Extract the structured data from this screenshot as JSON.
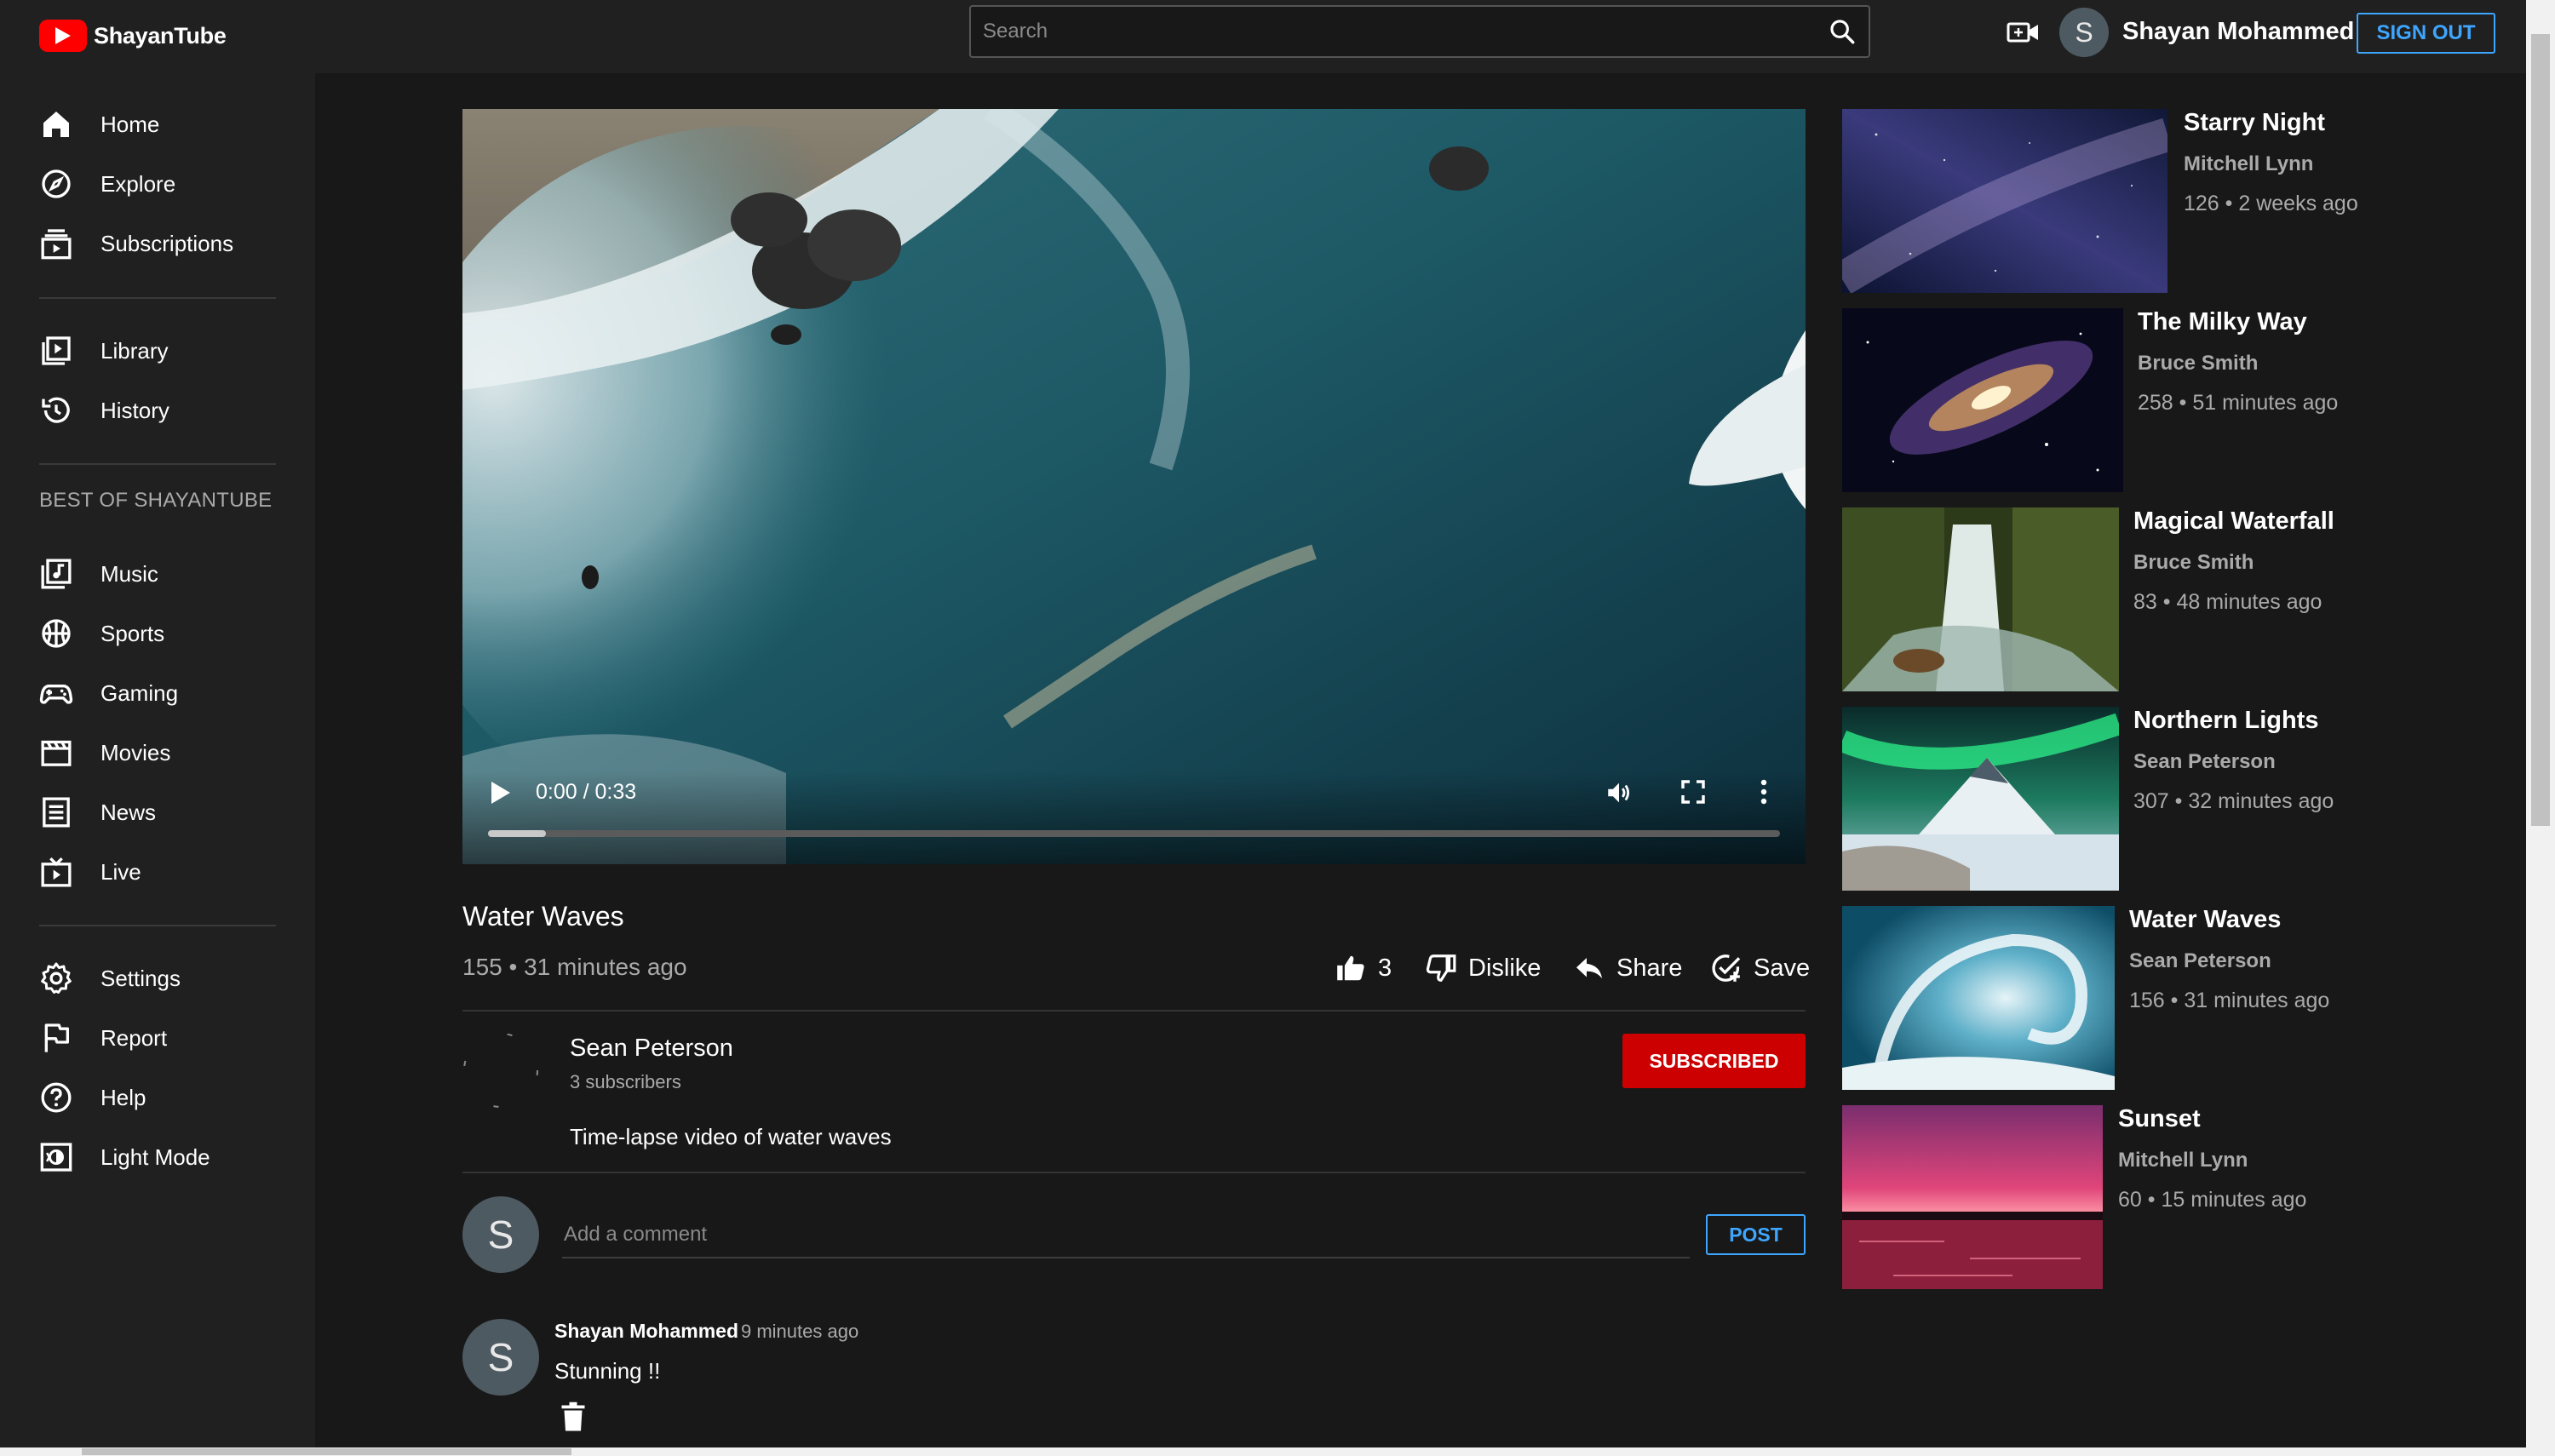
{
  "app": {
    "name": "ShayanTube"
  },
  "search": {
    "placeholder": "Search"
  },
  "user": {
    "initial": "S",
    "name": "Shayan Mohammed",
    "signout_label": "SIGN OUT"
  },
  "sidebar": {
    "items": [
      {
        "label": "Home",
        "icon": "home-icon"
      },
      {
        "label": "Explore",
        "icon": "compass-icon"
      },
      {
        "label": "Subscriptions",
        "icon": "subscriptions-icon"
      },
      {
        "label": "Library",
        "icon": "library-icon"
      },
      {
        "label": "History",
        "icon": "history-icon"
      }
    ],
    "section_title": "BEST OF SHAYANTUBE",
    "best_of": [
      {
        "label": "Music",
        "icon": "music-icon"
      },
      {
        "label": "Sports",
        "icon": "sports-icon"
      },
      {
        "label": "Gaming",
        "icon": "gaming-icon"
      },
      {
        "label": "Movies",
        "icon": "movies-icon"
      },
      {
        "label": "News",
        "icon": "news-icon"
      },
      {
        "label": "Live",
        "icon": "live-icon"
      }
    ],
    "bottom": [
      {
        "label": "Settings",
        "icon": "gear-icon"
      },
      {
        "label": "Report",
        "icon": "flag-icon"
      },
      {
        "label": "Help",
        "icon": "help-icon"
      },
      {
        "label": "Light Mode",
        "icon": "light-mode-icon"
      }
    ]
  },
  "player": {
    "time": "0:00 / 0:33",
    "progress_buffered": 0.045
  },
  "video": {
    "title": "Water Waves",
    "meta": "155 • 31 minutes ago",
    "likes": "3",
    "dislike_label": "Dislike",
    "share_label": "Share",
    "save_label": "Save"
  },
  "channel": {
    "name": "Sean Peterson",
    "subscribers": "3 subscribers",
    "description": "Time-lapse video of water waves",
    "subscribe_label": "SUBSCRIBED"
  },
  "comments": {
    "placeholder": "Add a comment",
    "post_label": "POST",
    "items": [
      {
        "initial": "S",
        "author": "Shayan Mohammed",
        "time": "9 minutes ago",
        "text": "Stunning !!"
      }
    ]
  },
  "related": [
    {
      "title": "Starry Night",
      "author": "Mitchell Lynn",
      "meta": "126 • 2 weeks ago"
    },
    {
      "title": "The Milky Way",
      "author": "Bruce Smith",
      "meta": "258 • 51 minutes ago"
    },
    {
      "title": "Magical Waterfall",
      "author": "Bruce Smith",
      "meta": "83 • 48 minutes ago"
    },
    {
      "title": "Northern Lights",
      "author": "Sean Peterson",
      "meta": "307 • 32 minutes ago"
    },
    {
      "title": "Water Waves",
      "author": "Sean Peterson",
      "meta": "156 • 31 minutes ago"
    },
    {
      "title": "Sunset",
      "author": "Mitchell Lynn",
      "meta": "60 • 15 minutes ago"
    }
  ],
  "colors": {
    "accent": "#3ea6ff",
    "brand": "#ff0000",
    "subscribe": "#cc0000",
    "background": "#181818",
    "panel": "#202020"
  }
}
